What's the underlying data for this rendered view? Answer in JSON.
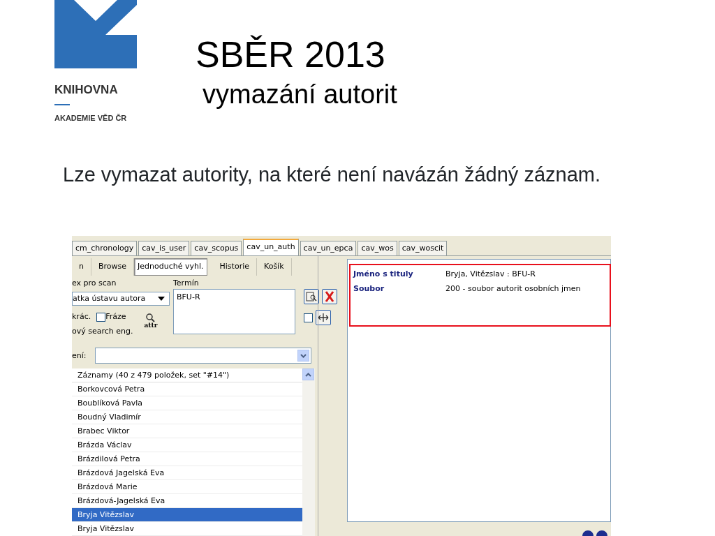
{
  "logo": {
    "name": "KNIHOVNA",
    "subtitle": "AKADEMIE VĚD ČR"
  },
  "title": "SBĚR 2013",
  "subtitle": "vymazání autorit",
  "bullet": "Lze vymazat autority, na které není navázán žádný záznam.",
  "screenshot": {
    "tabs": [
      {
        "label": "cm_chronology",
        "selected": false
      },
      {
        "label": "cav_is_user",
        "selected": false
      },
      {
        "label": "cav_scopus",
        "selected": false
      },
      {
        "label": "cav_un_auth",
        "selected": true
      },
      {
        "label": "cav_un_epca",
        "selected": false
      },
      {
        "label": "cav_wos",
        "selected": false
      },
      {
        "label": "cav_woscit",
        "selected": false
      }
    ],
    "subtabs": [
      {
        "label": "n",
        "selected": false
      },
      {
        "label": "Browse",
        "selected": false
      },
      {
        "label": "Jednoduché vyhl.",
        "selected": true
      },
      {
        "label": "Historie",
        "selected": false
      },
      {
        "label": "Košík",
        "selected": false
      }
    ],
    "index_label": "ex pro scan",
    "index_value": "atka ústavu autora",
    "term_label": "Termín",
    "term_value": "BFU-R",
    "truncate_label": "krác.",
    "phrase": {
      "label": "Fráze",
      "checked": false
    },
    "engine_label": "ový search eng.",
    "attr_label": "attr",
    "extra_checkbox": {
      "checked": false
    },
    "sort_label": "ení:",
    "list": {
      "header": "Záznamy (40 z 479 položek, set \"#14\")",
      "rows": [
        {
          "text": "Borkovcová Petra",
          "selected": false
        },
        {
          "text": "Boublíková Pavla",
          "selected": false
        },
        {
          "text": "Boudný Vladimír",
          "selected": false
        },
        {
          "text": "Brabec Viktor",
          "selected": false
        },
        {
          "text": "Brázda Václav",
          "selected": false
        },
        {
          "text": "Brázdilová Petra",
          "selected": false
        },
        {
          "text": "Brázdová Jagelská Eva",
          "selected": false
        },
        {
          "text": "Brázdová Marie",
          "selected": false
        },
        {
          "text": "Brázdová-Jagelská Eva",
          "selected": false
        },
        {
          "text": "Bryja Vitězslav",
          "selected": true
        },
        {
          "text": "Bryja Vitězslav",
          "selected": false
        }
      ]
    },
    "details": [
      {
        "label": "Jméno s tituly",
        "value": "Bryja, Vitězslav : BFU-R"
      },
      {
        "label": "Soubor",
        "value": "200 - soubor autorit osobních jmen"
      }
    ]
  }
}
